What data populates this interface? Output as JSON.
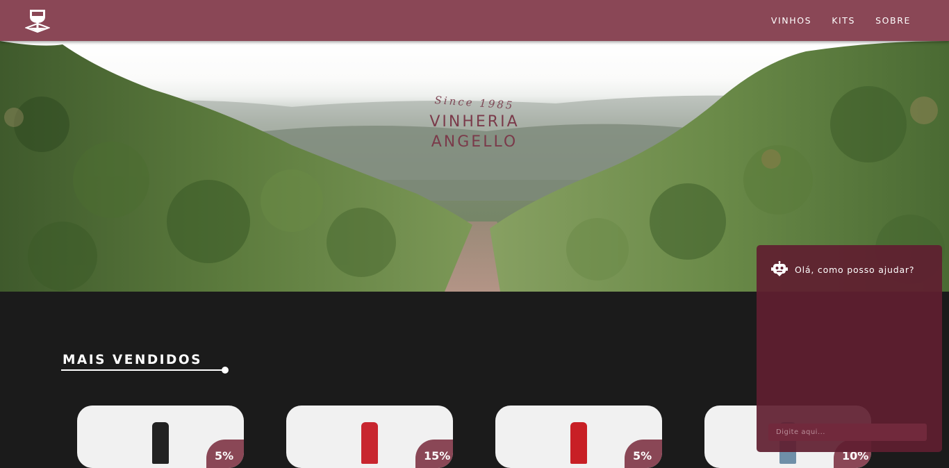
{
  "header": {
    "nav": [
      "VINHOS",
      "KITS",
      "SOBRE"
    ]
  },
  "hero": {
    "since": "Since 1985",
    "brand_line1": "VINHERIA",
    "brand_line2": "ANGELLO"
  },
  "section": {
    "title": "MAIS VENDIDOS"
  },
  "products": [
    {
      "discount": "5%",
      "bottle_color": "#222222"
    },
    {
      "discount": "15%",
      "bottle_color": "#c8262f"
    },
    {
      "discount": "5%",
      "bottle_color": "#c81f25"
    },
    {
      "discount": "10%",
      "bottle_color": "#6f8fa8"
    }
  ],
  "chat": {
    "greeting": "Olá, como posso ajudar?",
    "placeholder": "Digite aqui..."
  },
  "colors": {
    "brand": "#8a4756",
    "chat_bg": "#601e30",
    "page_bg": "#1b1b1b"
  },
  "icons": {
    "logo": "wine-glass-icon",
    "chat": "robot-icon"
  }
}
